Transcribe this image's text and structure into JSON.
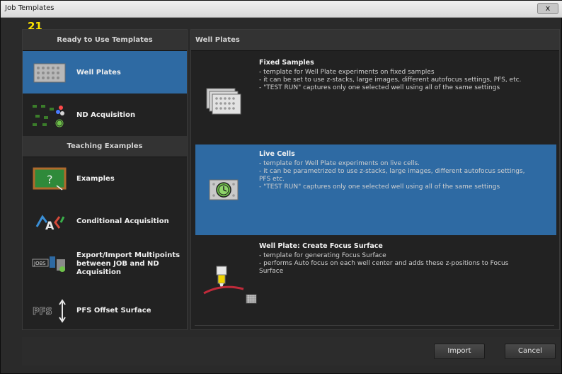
{
  "window": {
    "title": "Job Templates",
    "close_label": "x",
    "step_number": "21"
  },
  "left_panel": {
    "section1": "Ready to Use Templates",
    "section2": "Teaching Examples",
    "items": [
      {
        "label": "Well Plates",
        "icon": "well-plate-icon",
        "selected": true
      },
      {
        "label": "ND Acquisition",
        "icon": "nd-acquisition-icon"
      },
      {
        "label": "Examples",
        "icon": "blackboard-icon"
      },
      {
        "label": "Conditional Acquisition",
        "icon": "conditional-icon"
      },
      {
        "label_lines": [
          "Export/Import Multipoints",
          "between JOB and ND",
          "Acquisition"
        ],
        "icon": "export-import-icon"
      },
      {
        "label": "PFS Offset Surface",
        "icon": "pfs-icon"
      }
    ]
  },
  "right_panel": {
    "header": "Well Plates",
    "templates": [
      {
        "title": "Fixed Samples",
        "lines": [
          "- template for Well Plate experiments on fixed samples",
          "- it can be set to use z-stacks, large images, different autofocus settings, PFS, etc.",
          "- \"TEST RUN\" captures only one selected well using all of the same settings"
        ],
        "icon": "well-plate-stack-icon"
      },
      {
        "title": "Live Cells",
        "lines": [
          "- template for Well Plate experiments on live cells.",
          "- it can be parametrized to use z-stacks, large images, different autofocus settings,",
          "PFS etc.",
          "- \"TEST RUN\" captures only one selected well using all of the same settings"
        ],
        "icon": "timelapse-plate-icon",
        "selected": true
      },
      {
        "title": "Well Plate: Create Focus Surface",
        "lines": [
          "- template for generating Focus Surface",
          "- performs Auto focus on each well center and adds these z-positions to Focus",
          "Surface"
        ],
        "icon": "focus-surface-icon"
      }
    ]
  },
  "buttons": {
    "import": "Import",
    "cancel": "Cancel"
  },
  "colors": {
    "selection": "#2e6aa3",
    "step_number": "#ffe600"
  }
}
